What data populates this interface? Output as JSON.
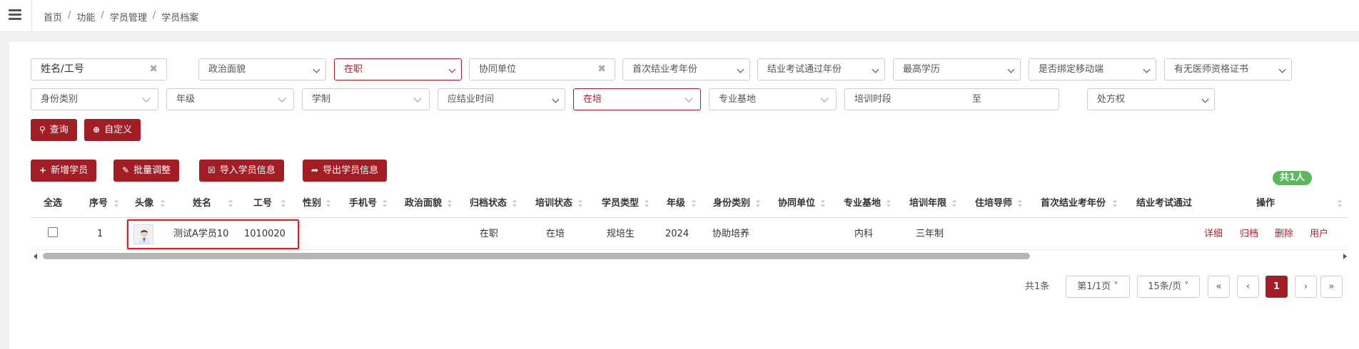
{
  "breadcrumb": {
    "home": "首页",
    "func": "功能",
    "mgmt": "学员管理",
    "current": "学员档案",
    "sep": "/"
  },
  "filters": {
    "name": "姓名/工号",
    "politics": "政治面貌",
    "status": "在职",
    "partner_unit": "协同单位",
    "first_exam_year": "首次结业考年份",
    "exam_pass_year": "结业考试通过年份",
    "education": "最高学历",
    "mobile_bound": "是否绑定移动端",
    "license": "有无医师资格证书",
    "identity": "身份类别",
    "grade": "年级",
    "system": "学制",
    "grad_time": "应结业时间",
    "training_status": "在培",
    "base": "专业基地",
    "period": "培训时段",
    "period_to": "至",
    "prescription": "处方权",
    "clear_glyph": "✖"
  },
  "buttons": {
    "query": "查询",
    "custom": "自定义",
    "add": "新增学员",
    "batch": "批量调整",
    "import": "导入学员信息",
    "export": "导出学员信息"
  },
  "total_badge": "共1人",
  "table": {
    "headers": [
      "全选",
      "序号",
      "头像",
      "姓名",
      "工号",
      "性别",
      "手机号",
      "政治面貌",
      "归档状态",
      "培训状态",
      "学员类型",
      "年级",
      "身份类别",
      "协同单位",
      "专业基地",
      "培训年限",
      "住培导师",
      "首次结业考年份",
      "结业考试通过",
      "操作"
    ],
    "row": {
      "index": "1",
      "name": "测试A学员10",
      "emp_no": "1010020",
      "archive_status": "在职",
      "training_status": "在培",
      "student_type": "规培生",
      "grade": "2024",
      "identity": "协助培养",
      "base": "内科",
      "years": "三年制",
      "actions": [
        "详细",
        "归档",
        "删除",
        "用户"
      ]
    }
  },
  "pager": {
    "total": "共1条",
    "page": "第1/1页",
    "per_page": "15条/页",
    "current": "1",
    "first": "«",
    "prev": "‹",
    "next": "›",
    "last": "»"
  },
  "colors": {
    "brand": "#a31d24",
    "badge": "#5cb85c",
    "highlight": "#e02020"
  }
}
